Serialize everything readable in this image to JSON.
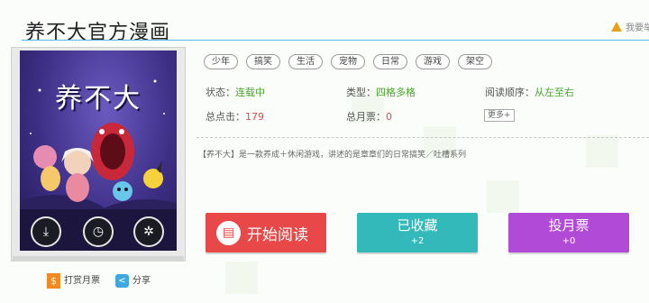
{
  "title": "养不大官方漫画",
  "report_label": "我要举",
  "tags": [
    "少年",
    "搞笑",
    "生活",
    "宠物",
    "日常",
    "游戏",
    "架空"
  ],
  "info": {
    "status_label": "状态：",
    "status_value": "连载中",
    "type_label": "类型：",
    "type_value": "四格多格",
    "read_order_label": "阅读顺序：",
    "read_order_value": "从左至右",
    "clicks_label": "总点击：",
    "clicks_value": "179",
    "monthly_label": "总月票：",
    "monthly_value": "0",
    "more_label": "更多+"
  },
  "description": "【养不大】是一款养成＋休闲游戏，讲述的是章章们的日常搞笑／吐槽系列",
  "cover": {
    "logo_text": "养不大",
    "actions": [
      "download-icon",
      "timer-icon",
      "web-icon"
    ]
  },
  "buttons": {
    "read_label": "开始阅读",
    "fav_label": "已收藏",
    "fav_count": "+2",
    "vote_label": "投月票",
    "vote_count": "+0"
  },
  "footer": {
    "tip_label": "打赏月票",
    "share_label": "分享"
  },
  "colors": {
    "accent_line": "#55b8e8",
    "read": "#e84848",
    "fav": "#33b9b9",
    "vote": "#b14ad6",
    "status_green": "#4aa52e",
    "count_red": "#e04a4a"
  }
}
